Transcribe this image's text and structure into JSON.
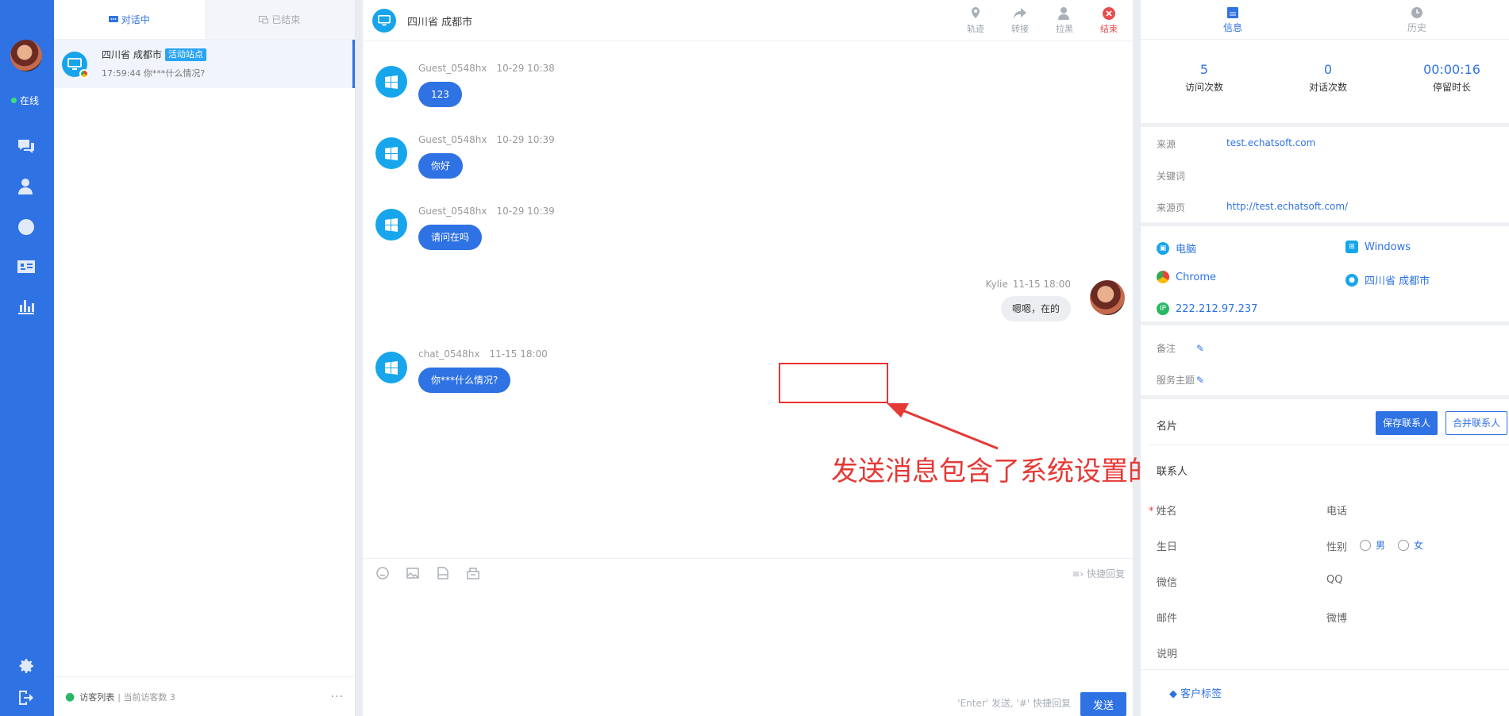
{
  "rail": {
    "status": "在线",
    "items": [
      "chat-icon",
      "visitor-icon",
      "history-icon",
      "contacts-icon",
      "stats-icon"
    ],
    "bottom": [
      "settings-icon",
      "logout-icon"
    ]
  },
  "conversation_list": {
    "tab_active": "对话中",
    "tab_ended": "已结束",
    "items": [
      {
        "location": "四川省 成都市",
        "badge": "活动站点",
        "time_preview": "17:59:44 你***什么情况?"
      }
    ],
    "footer_label": "访客列表",
    "footer_count": "| 当前访客数 3",
    "footer_more": "···"
  },
  "chat": {
    "header_location": "四川省 成都市",
    "actions": [
      {
        "label": "轨迹",
        "icon": "track-icon"
      },
      {
        "label": "转接",
        "icon": "transfer-icon"
      },
      {
        "label": "拉黑",
        "icon": "block-icon"
      },
      {
        "label": "结束",
        "icon": "end-icon"
      }
    ],
    "messages": [
      {
        "sender": "Guest_0548hx",
        "time": "10-29 10:38",
        "text": "123"
      },
      {
        "sender": "Guest_0548hx",
        "time": "10-29 10:39",
        "text": "你好"
      },
      {
        "sender": "Guest_0548hx",
        "time": "10-29 10:39",
        "text": "请问在吗"
      },
      {
        "sender": "Kylie",
        "time": "11-15 18:00",
        "text": "嗯嗯，在的"
      },
      {
        "sender": "chat_0548hx",
        "time": "11-15 18:00",
        "text": "你***什么情况?"
      }
    ],
    "annotation": "发送消息包含了系统设置的访客敏感词",
    "quick_reply": "快捷回复",
    "send_hint": "'Enter' 发送, '#' 快捷回复",
    "send_label": "发送"
  },
  "info": {
    "tab_info": "信息",
    "tab_history": "历史",
    "stats": [
      {
        "value": "5",
        "label": "访问次数"
      },
      {
        "value": "0",
        "label": "对话次数"
      },
      {
        "value": "00:00:16",
        "label": "停留时长"
      }
    ],
    "source_label": "来源",
    "source_value": "test.echatsoft.com",
    "keyword_label": "关键词",
    "page_label": "来源页",
    "page_value": "http://test.echatsoft.com/",
    "device": "电脑",
    "os": "Windows",
    "browser": "Chrome",
    "region": "四川省 成都市",
    "ip_badge": "IP",
    "ip": "222.212.97.237",
    "remark_label": "备注",
    "topic_label": "服务主题",
    "card_label": "名片",
    "save_contact": "保存联系人",
    "merge_contact": "合并联系人",
    "contact_title": "联系人",
    "fields": {
      "name": "姓名",
      "phone": "电话",
      "birthday": "生日",
      "gender": "性别",
      "male": "男",
      "female": "女",
      "wechat": "微信",
      "qq": "QQ",
      "email": "邮件",
      "weibo": "微博",
      "desc": "说明"
    },
    "tags_label": "客户标签"
  },
  "colors": {
    "primary": "#2f72e3",
    "accent_cyan": "#17a6ec",
    "danger": "#e53935"
  }
}
